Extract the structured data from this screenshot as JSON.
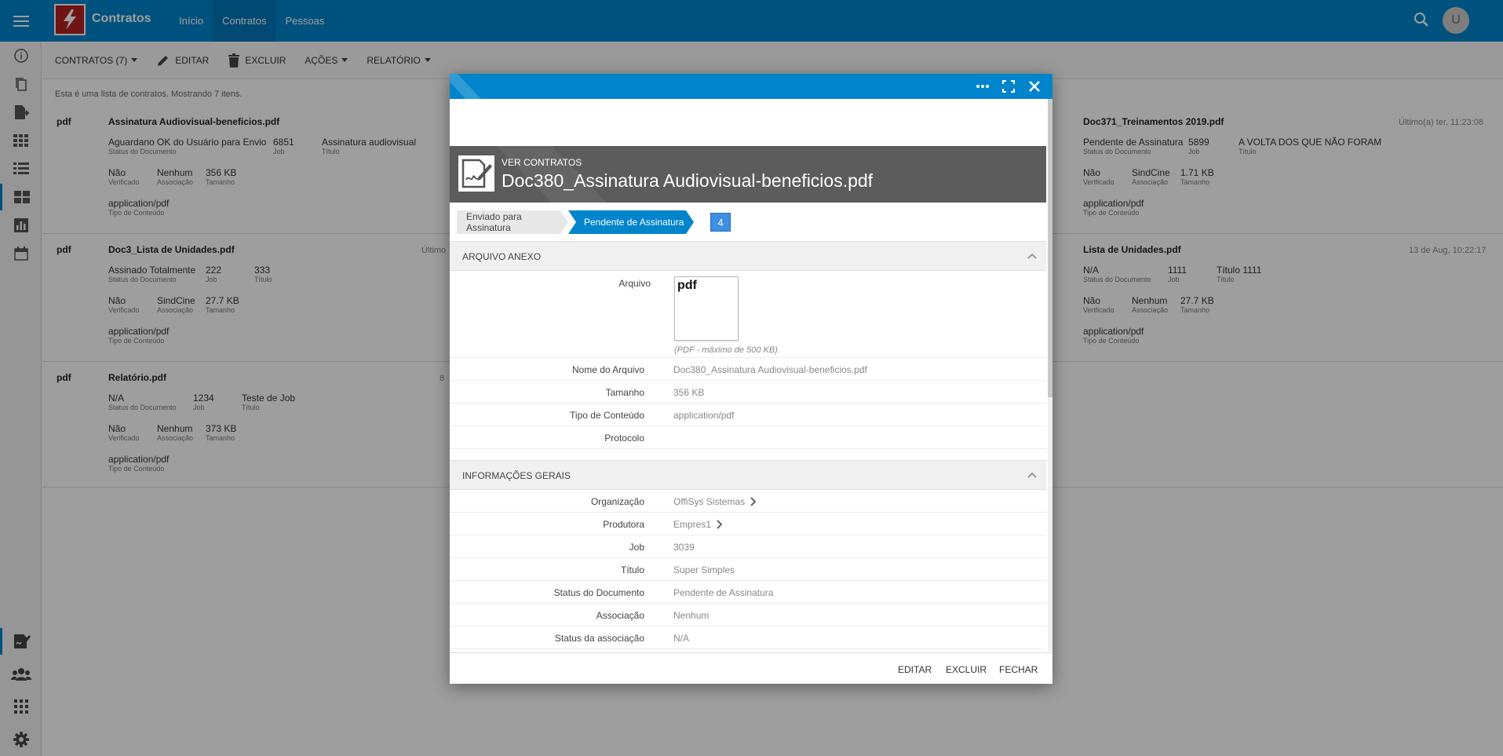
{
  "app": {
    "title": "Contratos",
    "nav": [
      "Início",
      "Contratos",
      "Pessoas"
    ],
    "avatar": "U"
  },
  "toolbar": {
    "contratos": "CONTRATOS (7)",
    "editar": "EDITAR",
    "excluir": "EXCLUIR",
    "acoes": "AÇÕES",
    "relatorio": "RELATÓRIO"
  },
  "list_info": "Esta é uma lista de contratos. Mostrando 7 itens.",
  "rows": [
    {
      "badge": "pdf",
      "left": {
        "title": "Assinatura Audiovisual-beneficios.pdf",
        "l1": [
          {
            "v": "Aguardano OK do Usuário para Envio",
            "k": "Status do Documento"
          },
          {
            "v": "6851",
            "k": "Job"
          },
          {
            "v": "Assinatura audiovisual",
            "k": "Título"
          }
        ],
        "l2": [
          {
            "v": "Não",
            "k": "Verificado"
          },
          {
            "v": "Nenhum",
            "k": "Associação"
          },
          {
            "v": "356 KB",
            "k": "Tamanho"
          }
        ],
        "l3": {
          "v": "application/pdf",
          "k": "Tipo de Conteúdo"
        }
      },
      "right": {
        "title": "Doc371_Treinamentos 2019.pdf",
        "date": "Último(a) ter, 11:23:08",
        "l1": [
          {
            "v": "Pendente de Assinatura",
            "k": "Status do Documento"
          },
          {
            "v": "5899",
            "k": "Job"
          },
          {
            "v": "A VOLTA DOS QUE NÃO FORAM",
            "k": "Título"
          }
        ],
        "l2": [
          {
            "v": "Não",
            "k": "Verificado"
          },
          {
            "v": "SindCine",
            "k": "Associação"
          },
          {
            "v": "1.71 KB",
            "k": "Tamanho"
          }
        ],
        "l3": {
          "v": "application/pdf",
          "k": "Tipo de Conteúdo"
        }
      }
    },
    {
      "badge": "pdf",
      "mid": "Último",
      "left": {
        "title": "Doc3_Lista de Unidades.pdf",
        "l1": [
          {
            "v": "Assinado Totalmente",
            "k": "Status do Documento"
          },
          {
            "v": "222",
            "k": "Job"
          },
          {
            "v": "333",
            "k": "Título"
          }
        ],
        "l2": [
          {
            "v": "Não",
            "k": "Verificado"
          },
          {
            "v": "SindCine",
            "k": "Associação"
          },
          {
            "v": "27.7 KB",
            "k": "Tamanho"
          }
        ],
        "l3": {
          "v": "application/pdf",
          "k": "Tipo de Conteúdo"
        }
      },
      "right": {
        "title": "Lista de Unidades.pdf",
        "date": "13 de Aug, 10:22:17",
        "l1": [
          {
            "v": "N/A",
            "k": "Status do Documento"
          },
          {
            "v": "1111",
            "k": "Job"
          },
          {
            "v": "Título 1111",
            "k": "Título"
          }
        ],
        "l2": [
          {
            "v": "Não",
            "k": "Verificado"
          },
          {
            "v": "Nenhum",
            "k": "Associação"
          },
          {
            "v": "27.7 KB",
            "k": "Tamanho"
          }
        ],
        "l3": {
          "v": "application/pdf",
          "k": "Tipo de Conteúdo"
        }
      }
    },
    {
      "badge": "pdf",
      "mid": "8",
      "left": {
        "title": "Relatório.pdf",
        "l1": [
          {
            "v": "N/A",
            "k": "Status do Documento"
          },
          {
            "v": "1234",
            "k": "Job"
          },
          {
            "v": "Teste de Job",
            "k": "Título"
          }
        ],
        "l2": [
          {
            "v": "Não",
            "k": "Verificado"
          },
          {
            "v": "Nenhum",
            "k": "Associação"
          },
          {
            "v": "373 KB",
            "k": "Tamanho"
          }
        ],
        "l3": {
          "v": "application/pdf",
          "k": "Tipo de Conteúdo"
        }
      }
    }
  ],
  "modal": {
    "subtitle": "VER CONTRATOS",
    "title": "Doc380_Assinatura Audiovisual-beneficios.pdf",
    "steps": [
      "Enviado para Assinatura",
      "Pendente de Assinatura"
    ],
    "step_count": "4",
    "sec1": "ARQUIVO ANEXO",
    "arquivo_label": "Arquivo",
    "file_badge": "pdf",
    "file_hint": "(PDF - máximo de 500 KB)",
    "file_fields": [
      {
        "label": "Nome do Arquivo",
        "value": "Doc380_Assinatura Audiovisual-beneficios.pdf"
      },
      {
        "label": "Tamanho",
        "value": "356 KB"
      },
      {
        "label": "Tipo de Conteúdo",
        "value": "application/pdf"
      },
      {
        "label": "Protocolo",
        "value": ""
      }
    ],
    "sec2": "INFORMAÇÕES GERAIS",
    "general_fields": [
      {
        "label": "Organização",
        "value": "OffiSys Sistemas",
        "link": true
      },
      {
        "label": "Produtora",
        "value": "Empres1",
        "link": true
      },
      {
        "label": "Job",
        "value": "3039"
      },
      {
        "label": "Título",
        "value": "Super Simples"
      },
      {
        "label": "Status do Documento",
        "value": "Pendente de Assinatura"
      },
      {
        "label": "Associação",
        "value": "Nenhum"
      },
      {
        "label": "Status da associação",
        "value": "N/A"
      }
    ],
    "footer": {
      "editar": "EDITAR",
      "excluir": "EXCLUIR",
      "fechar": "FECHAR"
    }
  }
}
